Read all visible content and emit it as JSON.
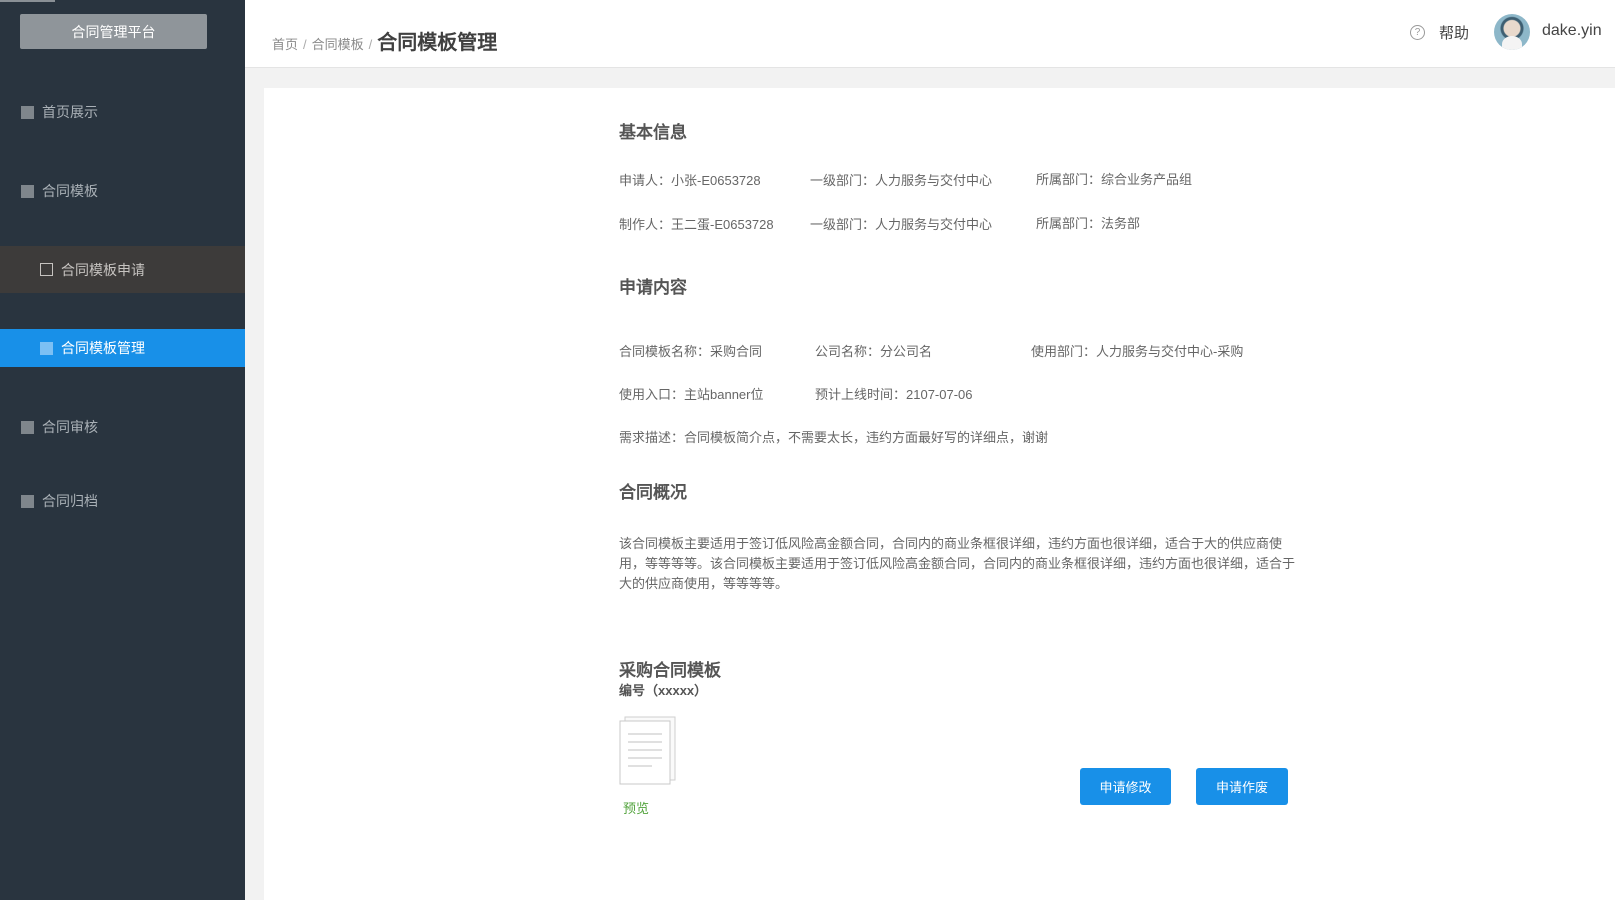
{
  "sidebar": {
    "platform_label": "合同管理平台",
    "items": [
      {
        "label": "首页展示"
      },
      {
        "label": "合同模板"
      },
      {
        "label": "合同模板申请"
      },
      {
        "label": "合同模板管理"
      },
      {
        "label": "合同审核"
      },
      {
        "label": "合同归档"
      }
    ]
  },
  "header": {
    "breadcrumb": [
      "首页",
      "合同模板"
    ],
    "breadcrumb_sep": "/",
    "title": "合同模板管理",
    "help_icon": "question-circle-icon",
    "help_label": "帮助",
    "username": "dake.yin"
  },
  "basic": {
    "title": "基本信息",
    "applicant": "申请人：小张-E0653728",
    "applicant_dept1": "一级部门：人力服务与交付中心",
    "applicant_dept2": "所属部门：综合业务产品组",
    "maker": "制作人：王二蛋-E0653728",
    "maker_dept1": "一级部门：人力服务与交付中心",
    "maker_dept2": "所属部门：法务部"
  },
  "request": {
    "title": "申请内容",
    "template_name": "合同模板名称：采购合同",
    "company_name": "公司名称：分公司名",
    "use_dept": "使用部门：人力服务与交付中心-采购",
    "entry": "使用入口：主站banner位",
    "launch_time": "预计上线时间：2107-07-06",
    "description": "需求描述：合同模板简介点，不需要太长，违约方面最好写的详细点，谢谢"
  },
  "overview": {
    "title": "合同概况",
    "text": "该合同模板主要适用于签订低风险高金额合同，合同内的商业条框很详细，违约方面也很详细，适合于大的供应商使用，等等等等。该合同模板主要适用于签订低风险高金额合同，合同内的商业条框很详细，违约方面也很详细，适合于大的供应商使用，等等等等。"
  },
  "template": {
    "title": "采购合同模板",
    "code": "编号（xxxxx）",
    "doc_icon": "document-icon",
    "preview_label": "预览",
    "preview_color": "#52a33c"
  },
  "actions": {
    "modify_label": "申请修改",
    "void_label": "申请作废",
    "accent": "#1890e8"
  }
}
